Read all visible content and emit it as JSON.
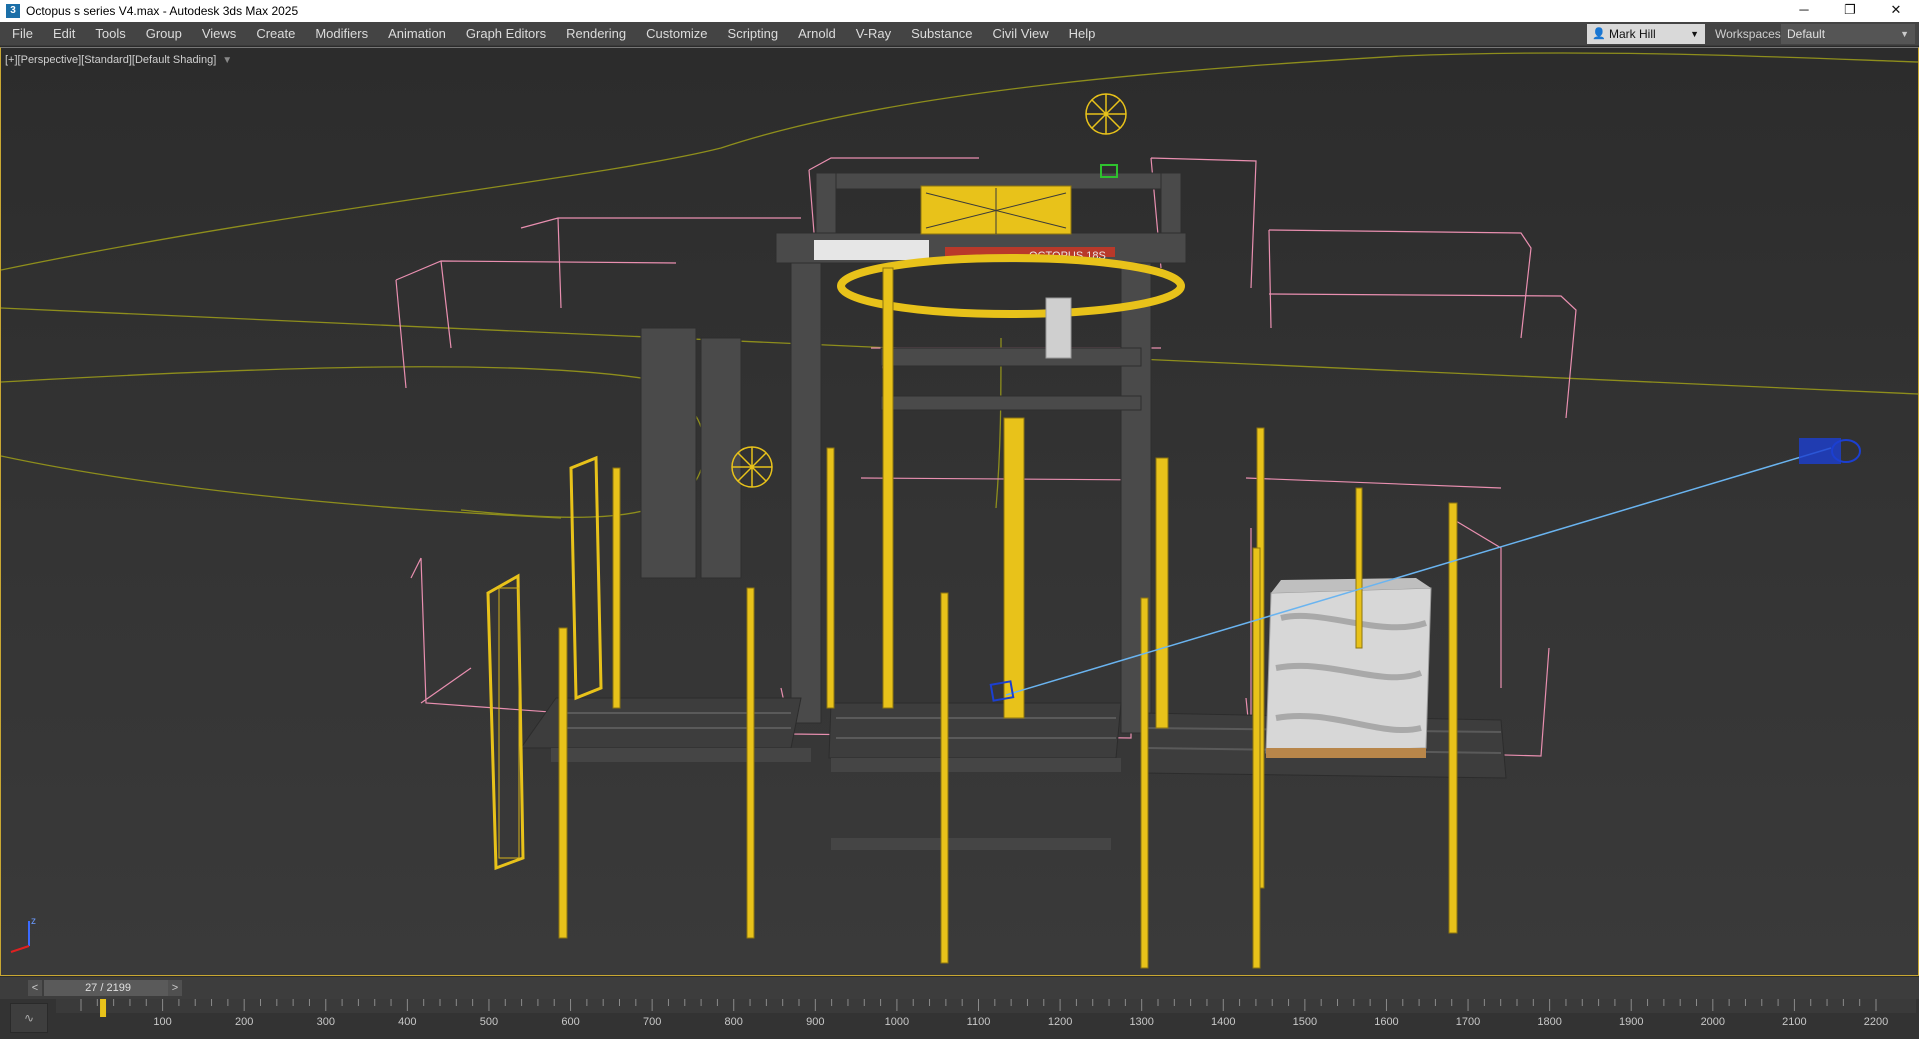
{
  "window": {
    "title": "Octopus s series V4.max - Autodesk 3ds Max 2025",
    "app_icon": "3",
    "controls": [
      "─",
      "❐",
      "✕"
    ]
  },
  "menu": {
    "items": [
      "File",
      "Edit",
      "Tools",
      "Group",
      "Views",
      "Create",
      "Modifiers",
      "Animation",
      "Graph Editors",
      "Rendering",
      "Customize",
      "Scripting",
      "Arnold",
      "V-Ray",
      "Substance",
      "Civil View",
      "Help"
    ],
    "user_name": "Mark Hill",
    "workspaces_label": "Workspaces:",
    "workspace_value": "Default"
  },
  "viewport": {
    "label_parts": [
      "[+]",
      "[Perspective]",
      "[Standard]",
      "[Default Shading]"
    ],
    "machine_label": "OCTOPUS 18S",
    "axis_label": "z"
  },
  "time_slider": {
    "prev": "<",
    "next": ">",
    "frame": "27 / 2199"
  },
  "trackbar": {
    "ticks": [
      "100",
      "200",
      "300",
      "400",
      "500",
      "600",
      "700",
      "800",
      "900",
      "1000",
      "1100",
      "1200",
      "1300",
      "1400",
      "1500",
      "1600",
      "1700",
      "1800",
      "1900",
      "2000",
      "2100",
      "2200"
    ],
    "current_frame_marker": 27
  },
  "colors": {
    "accent_yellow": "#e8c21a",
    "frame_gray": "#4a4a4a",
    "bbox_pink": "#e98fb0",
    "spline_olive": "#8e8e1c",
    "camera_blue": "#1b3fd1",
    "target_line": "#6ab4f0"
  },
  "icons": {
    "user": "user-icon",
    "filter": "filter-icon",
    "curve_editor": "curve-editor-icon"
  }
}
